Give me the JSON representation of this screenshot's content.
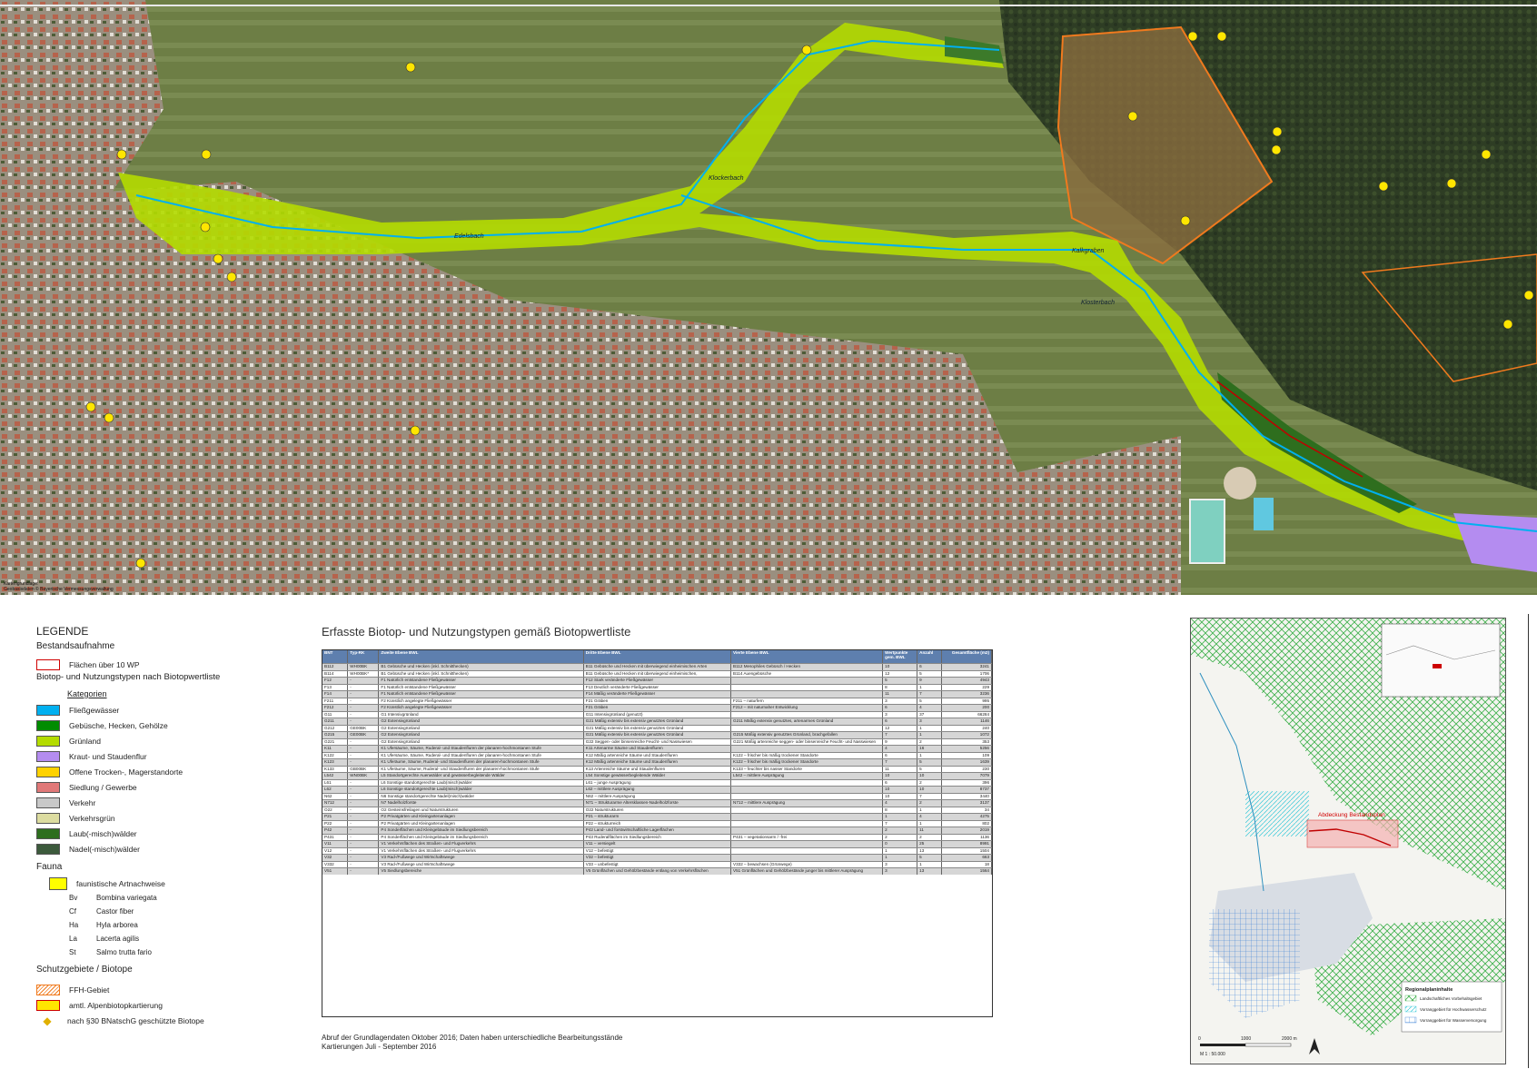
{
  "map": {
    "credit_lines": [
      "Kartengrundlage:",
      "Geobasisdaten © Bayerische Vermessungsverwaltung"
    ],
    "stream_labels": [
      "Edelsbach",
      "Klockerbach",
      "Kalkgraben",
      "Klosterbach"
    ]
  },
  "legend": {
    "title": "LEGENDE",
    "bestand": "Bestandsaufnahme",
    "wp_label": "Flächen über 10 WP",
    "biotop_heading": "Biotop- und Nutzungstypen nach Biotopwertliste",
    "kategorien": "Kategorien",
    "categories": [
      {
        "label": "Fließgewässer",
        "color": "#00b0f0"
      },
      {
        "label": "Gebüsche, Hecken, Gehölze",
        "color": "#008c00"
      },
      {
        "label": "Grünland",
        "color": "#b4dc00"
      },
      {
        "label": "Kraut- und Staudenflur",
        "color": "#b48cf0"
      },
      {
        "label": "Offene Trocken-, Magerstandorte",
        "color": "#ffd200"
      },
      {
        "label": "Siedlung / Gewerbe",
        "color": "#e07878"
      },
      {
        "label": "Verkehr",
        "color": "#c8c8c8"
      },
      {
        "label": "Verkehrsgrün",
        "color": "#dcdca0"
      },
      {
        "label": "Laub(-misch)wälder",
        "color": "#2e6e1e"
      },
      {
        "label": "Nadel(-misch)wälder",
        "color": "#3c5a3c"
      }
    ],
    "fauna_heading": "Fauna",
    "fauna_label": "faunistische Artnachweise",
    "species": [
      {
        "abbr": "Bv",
        "name": "Bombina variegata"
      },
      {
        "abbr": "Cf",
        "name": "Castor fiber"
      },
      {
        "abbr": "Ha",
        "name": "Hyla arborea"
      },
      {
        "abbr": "La",
        "name": "Lacerta agilis"
      },
      {
        "abbr": "St",
        "name": "Salmo trutta fario"
      }
    ],
    "schutz_heading": "Schutzgebiete / Biotope",
    "schutz": [
      "FFH-Gebiet",
      "amtl. Alpenbiotopkartierung",
      "nach §30 BNatschG geschützte Biotope"
    ]
  },
  "table": {
    "title": "Erfasste Biotop- und Nutzungstypen gemäß Biotopwertliste",
    "headers": [
      "BNT",
      "Typ-RK",
      "Zweite Ebene BWL",
      "Dritte Ebene BWL",
      "Vierte Ebene BWL",
      "Wertpunkte gem. BWL",
      "Anzahl",
      "Gesamtfläche (m2)"
    ],
    "rows": [
      [
        "B112",
        "WH00BK",
        "B1 Gebüsche und Hecken (inkl. Schnitthecken)",
        "B11 Gebüsche und Hecken mit überwiegend einheimischen Arten",
        "B112 Mesophiles Gebüsch / Hecken",
        "10",
        "6",
        "3241"
      ],
      [
        "B114",
        "WH00BK*",
        "B1 Gebüsche und Hecken (inkl. Schnitthecken)",
        "B11 Gebüsche und Hecken mit überwiegend einheimischen, standortgerechten Arten",
        "B114 Auengebüsche",
        "12",
        "5",
        "1706"
      ],
      [
        "F12",
        "-",
        "F1 Natürlich entstandene Fließgewässer",
        "F12 Stark veränderte Fließgewässer",
        "",
        "5",
        "9",
        "4943"
      ],
      [
        "F13",
        "-",
        "F1 Natürlich entstandene Fließgewässer",
        "F13 Deutlich veränderte Fließgewässer",
        "",
        "8",
        "1",
        "229"
      ],
      [
        "F14",
        "-",
        "F1 Natürlich entstandene Fließgewässer",
        "F14 Mäßig veränderte Fließgewässer",
        "",
        "11",
        "7",
        "3236"
      ],
      [
        "F211",
        "-",
        "F2 Künstlich angelegte Fließgewässer",
        "F21 Gräben",
        "F211 – naturfern",
        "3",
        "5",
        "995"
      ],
      [
        "F212",
        "-",
        "F2 Künstlich angelegte Fließgewässer",
        "F21 Gräben",
        "F212 – mit naturnaher Entwicklung",
        "6",
        "4",
        "200"
      ],
      [
        "G11",
        "-",
        "G1 Intensivgrünland",
        "G11 Intensivgrünland (genutzt)",
        "",
        "3",
        "37",
        "66284"
      ],
      [
        "G211",
        "-",
        "G2 Extensivgrünland",
        "G21 Mäßig extensiv bis extensiv genutztes Grünland",
        "G211 Mäßig extensiv genutztes, artenarmes Grünland",
        "6",
        "3",
        "1146"
      ],
      [
        "G212",
        "GE00BK",
        "G2 Extensivgrünland",
        "G21 Mäßig extensiv bis extensiv genutztes Grünland",
        "",
        "12",
        "1",
        "240"
      ],
      [
        "G215",
        "GE00BK",
        "G2 Extensivgrünland",
        "G21 Mäßig extensiv bis extensiv genutztes Grünland",
        "G215 Mäßig extensiv genutztes Grünland, brachgefallen",
        "7",
        "1",
        "1072"
      ],
      [
        "G221",
        "-",
        "G2 Extensivgrünland",
        "G22 Seggen- oder binsenreiche Feucht- und Nasswiesen",
        "G221 Mäßig artenreiche seggen- oder binsenreiche Feucht- und Nasswiesen",
        "9",
        "2",
        "353"
      ],
      [
        "K11",
        "-",
        "K1 Ufersäume, Säume, Ruderal- und Staudenfluren der planaren-hochmontanen Stufe",
        "K11 Artenarme Säume und Staudenfluren",
        "",
        "4",
        "16",
        "5256"
      ],
      [
        "K122",
        "-",
        "K1 Ufersäume, Säume, Ruderal- und Staudenfluren der planaren-hochmontanen Stufe",
        "K12 Mäßig artenreiche Säume und Staudenfluren",
        "K122 – frischer bis mäßig trockener Standorte",
        "6",
        "1",
        "109"
      ],
      [
        "K123",
        "-",
        "K1 Uferäume, Säume, Ruderal- und Staudenfluren der planaren-hochmontanen Stufe",
        "K12 Mäßig artenreiche Säume und Staudenfluren",
        "K122 – frischer bis mäßig trockener Standorte",
        "7",
        "5",
        "1639"
      ],
      [
        "K133",
        "GB00BK",
        "K1 Uferäume, Säume, Ruderal- und Staudenfluren der planaren-hochmontanen Stufe",
        "K13 Artenreiche Säume und Staudenfluren",
        "K133 – feuchter bis nasser Standorte",
        "11",
        "5",
        "230"
      ],
      [
        "L542",
        "WN00BK",
        "L5 Standortgerechte Auenwälder und gewässerbegleitende Wälder",
        "L54 Sonstige gewässerbegleitende Wälder",
        "L542 – mittlere Ausprägung",
        "10",
        "10",
        "7079"
      ],
      [
        "L61",
        "-",
        "L6 Sonstige standortgerechte Laub(misch)wälder",
        "L61 – junge Ausprägung",
        "",
        "6",
        "2",
        "396"
      ],
      [
        "L62",
        "-",
        "L6 Sonstige standortgerechte Laub(misch)wälder",
        "L62 – mittlere Ausprägung",
        "",
        "10",
        "10",
        "8737"
      ],
      [
        "N62",
        "-",
        "N6 Sonstige standortgerechte Nadel(misch)wälder",
        "N62 – mittlere Ausprägung",
        "",
        "10",
        "7",
        "3440"
      ],
      [
        "N712",
        "-",
        "N7 Nadelholzforste",
        "N71 – Strukturarme Altersklassen-Nadelholzforste",
        "N712 – mittlere Ausprägung",
        "4",
        "2",
        "3137"
      ],
      [
        "O22",
        "-",
        "O2 Gesteinsfreilagen und Naturstrukturen",
        "O22 Naturstrukturen",
        "",
        "8",
        "1",
        "34"
      ],
      [
        "P21",
        "-",
        "P2 Privatgärten und Kleingartenanlagen",
        "P21 – strukturarm",
        "",
        "1",
        "4",
        "4275"
      ],
      [
        "P22",
        "-",
        "P2 Privatgärten und Kleingartenanlagen",
        "P22 – strukturreich",
        "",
        "7",
        "1",
        "802"
      ],
      [
        "P42",
        "-",
        "P4 Sonderflächen und Kleingebäude im Siedlungsbereich",
        "P42 Land- und forstwirtschaftliche Lagerflächen",
        "",
        "2",
        "11",
        "2019"
      ],
      [
        "P431",
        "-",
        "P4 Sonderflächen und Kleingebäude im Siedlungsbereich",
        "P43 Ruderalflächen im Siedlungsbereich",
        "P431 – vegetationsarm / -frei",
        "2",
        "2",
        "1136"
      ],
      [
        "V11",
        "-",
        "V1 Verkehrsflächen des Straßen- und Flugverkehrs",
        "V11 – versiegelt",
        "",
        "0",
        "25",
        "8991"
      ],
      [
        "V12",
        "-",
        "V1 Verkehrsflächen des Straßen- und Flugverkehrs",
        "V12 – befestigt",
        "",
        "1",
        "13",
        "1504"
      ],
      [
        "V32",
        "-",
        "V3 Rad-/Fußwege und Wirtschaftswege",
        "V32 – befestigt",
        "",
        "1",
        "5",
        "663"
      ],
      [
        "V332",
        "-",
        "V3 Rad-/Fußwege und Wirtschaftswege",
        "V33 – unbefestigt",
        "V332 – bewachsen (Grünwege)",
        "3",
        "1",
        "18"
      ],
      [
        "V51",
        "-",
        "V5 Siedlungsbereiche",
        "V5 Grünflächen und Gehölzbestände entlang von Verkehrsflächen",
        "V51 Grünflächen und Gehölzbestände junger bis mittlerer Ausprägung",
        "3",
        "13",
        "1564"
      ]
    ],
    "footnote": [
      "Abruf der Grundlagendaten Oktober 2016; Daten haben unterschiedliche Bearbeitungsstände",
      "Kartierungen Juli - September 2016"
    ]
  },
  "inset": {
    "red_label": "Abdeckung Bestandsplan",
    "legend_title": "Regionalplaninhalte",
    "legend_items": [
      "Landschaftliches Vorbehaltsgebiet",
      "Vorranggebiet für Hochwasserschutz",
      "Vorranggebiet für Wasserversorgung"
    ],
    "scale_ticks": [
      "0",
      "1000",
      "2000 m"
    ],
    "scale_label": "M 1 : 50.000"
  }
}
